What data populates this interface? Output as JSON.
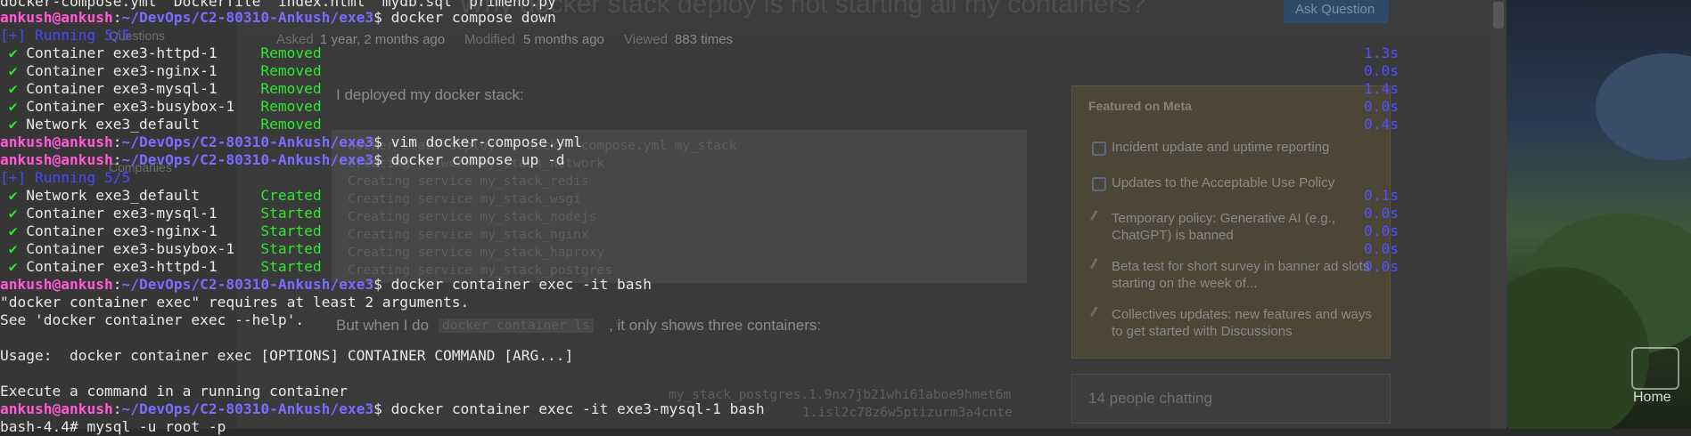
{
  "background_page": {
    "title": "Why docker stack deploy is not starting all my containers?",
    "ask_button": "Ask Question",
    "meta": {
      "asked_label": "Asked",
      "asked": "1 year, 2 months ago",
      "modified_label": "Modified",
      "modified": "5 months ago",
      "viewed_label": "Viewed",
      "viewed": "883 times"
    },
    "sidebar": {
      "questions": "Questions",
      "companies": "Companies"
    },
    "body_intro": "I deployed my docker stack:",
    "code_lines": [
      "docker stack deploy -c docker-compose.yml my_stack",
      "Creating network my_stack_network",
      "Creating service my_stack_redis",
      "Creating service my_stack_wsgi",
      "Creating service my_stack_nodejs",
      "Creating service my_stack_nginx",
      "Creating service my_stack_haproxy",
      "Creating service my_stack_postgres"
    ],
    "body_after": "But when I do",
    "inline_code": "docker container ls",
    "body_after2": ", it only shows three containers:",
    "code2_lines": [
      "my_stack_postgres.1.9nx7jb21whi61aboe9hmet6m",
      "1.isl2c78z6w5ptizurm3a4cnte"
    ],
    "featured": {
      "title": "Featured on Meta",
      "items": [
        {
          "icon": "meta-icon",
          "text": "Incident update and uptime reporting"
        },
        {
          "icon": "meta-icon",
          "text": "Updates to the Acceptable Use Policy"
        },
        {
          "icon": "pencil-icon",
          "text": "Temporary policy: Generative AI (e.g., ChatGPT) is banned"
        },
        {
          "icon": "pencil-icon",
          "text": "Beta test for short survey in banner ad slots starting on the week of..."
        },
        {
          "icon": "pencil-icon",
          "text": "Collectives updates: new features and ways to get started with Discussions"
        }
      ]
    },
    "chat": "14 people chatting",
    "desktop_home_label": "Home"
  },
  "terminal": {
    "prompt": {
      "user": "ankush@ankush",
      "path": "~/DevOps/C2-80310-Ankush/exe3"
    },
    "line0": "docker-compose.yml  Dockerfile  index.html  mydb.sql  primeno.py",
    "cmd1": "docker compose down",
    "running1": "[+] Running 5/5",
    "down_items": [
      {
        "check": "✔",
        "name": "Container exe3-httpd-1   ",
        "status": "Removed",
        "time": "1.3s"
      },
      {
        "check": "✔",
        "name": "Container exe3-nginx-1   ",
        "status": "Removed",
        "time": "0.0s"
      },
      {
        "check": "✔",
        "name": "Container exe3-mysql-1   ",
        "status": "Removed",
        "time": "1.4s"
      },
      {
        "check": "✔",
        "name": "Container exe3-busybox-1 ",
        "status": "Removed",
        "time": "0.0s"
      },
      {
        "check": "✔",
        "name": "Network exe3_default     ",
        "status": "Removed",
        "time": "0.4s"
      }
    ],
    "cmd2": "vim docker-compose.yml",
    "cmd3": "docker compose up -d",
    "running2": "[+] Running 5/5",
    "up_items": [
      {
        "check": "✔",
        "name": "Network exe3_default     ",
        "status": "Created",
        "time": "0.1s"
      },
      {
        "check": "✔",
        "name": "Container exe3-mysql-1   ",
        "status": "Started",
        "time": "0.0s"
      },
      {
        "check": "✔",
        "name": "Container exe3-nginx-1   ",
        "status": "Started",
        "time": "0.0s"
      },
      {
        "check": "✔",
        "name": "Container exe3-busybox-1 ",
        "status": "Started",
        "time": "0.0s"
      },
      {
        "check": "✔",
        "name": "Container exe3-httpd-1   ",
        "status": "Started",
        "time": "0.0s"
      }
    ],
    "cmd4": "docker container exec -it bash",
    "err1": "\"docker container exec\" requires at least 2 arguments.",
    "err2": "See 'docker container exec --help'.",
    "usage": "Usage:  docker container exec [OPTIONS] CONTAINER COMMAND [ARG...]",
    "exec_desc": "Execute a command in a running container",
    "cmd5": "docker container exec -it exe3-mysql-1 bash",
    "last": "bash-4.4# mysql -u root -p"
  }
}
